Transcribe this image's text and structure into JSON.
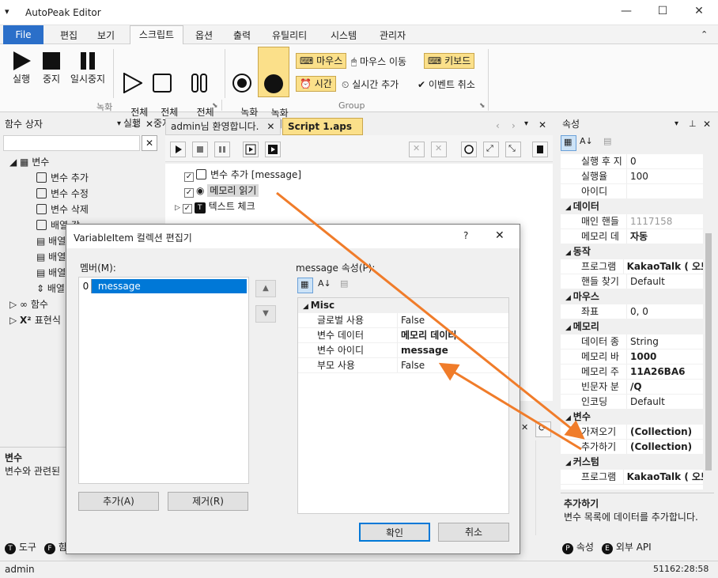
{
  "app": {
    "title": "AutoPeak Editor"
  },
  "menu": {
    "file": "File",
    "items": [
      "편집",
      "보기",
      "스크립트",
      "옵션",
      "출력",
      "유틸리티",
      "시스템",
      "관리자"
    ]
  },
  "ribbon": {
    "record_buttons": [
      "실행",
      "중지",
      "일시중지",
      "전체\n실행",
      "전체\n중지",
      "전체\n일시중지",
      "녹화\n시작",
      "녹화\n중지"
    ],
    "group_record": "녹화",
    "group_group": "Group",
    "chips": {
      "mouse": "마우스",
      "mouse_move": "마우스 이동",
      "keyboard": "키보드",
      "time": "시간",
      "realtime_add": "실시간 추가",
      "event_cancel": "이벤트 취소"
    }
  },
  "left_panel": {
    "title": "함수 상자",
    "tree": [
      "변수",
      "변수 추가",
      "변수 수정",
      "변수 삭제",
      "배열 값",
      "배열",
      "배열",
      "배열",
      "배열",
      "함수",
      "표현식"
    ],
    "desc_title": "변수",
    "desc_text": "변수와 관련된",
    "tabs": [
      "도구",
      "함"
    ]
  },
  "doc_tabs": {
    "tab1": "admin님 환영합니다.",
    "tab2": "Script 1.aps"
  },
  "script": {
    "rows": [
      "변수 추가 [message]",
      "메모리 읽기",
      "텍스트 체크"
    ]
  },
  "right_panel": {
    "title": "속성",
    "rows": [
      {
        "k": "실행 후 지",
        "v": "0",
        "cat": false
      },
      {
        "k": "실행율",
        "v": "100",
        "cat": false
      },
      {
        "k": "아이디",
        "v": "",
        "cat": false
      },
      {
        "k": "데이터",
        "v": "",
        "cat": true
      },
      {
        "k": "매인 핸들",
        "v": "1117158",
        "cat": false,
        "gray": true
      },
      {
        "k": "메모리 데",
        "v": "자동",
        "cat": false,
        "bold": true
      },
      {
        "k": "동작",
        "v": "",
        "cat": true
      },
      {
        "k": "프로그램",
        "v": "KakaoTalk ( 오토",
        "cat": false,
        "bold": true
      },
      {
        "k": "핸들 찾기",
        "v": "Default",
        "cat": false
      },
      {
        "k": "마우스",
        "v": "",
        "cat": true
      },
      {
        "k": "좌표",
        "v": "0, 0",
        "cat": false
      },
      {
        "k": "메모리",
        "v": "",
        "cat": true
      },
      {
        "k": "데이터 종",
        "v": "String",
        "cat": false
      },
      {
        "k": "메모리 바",
        "v": "1000",
        "cat": false,
        "bold": true
      },
      {
        "k": "메모리 주",
        "v": "11A26BA6",
        "cat": false,
        "bold": true
      },
      {
        "k": "빈문자 분",
        "v": "/Q",
        "cat": false,
        "bold": true
      },
      {
        "k": "인코딩",
        "v": "Default",
        "cat": false
      },
      {
        "k": "변수",
        "v": "",
        "cat": true
      },
      {
        "k": "가져오기",
        "v": "(Collection)",
        "cat": false,
        "bold": true
      },
      {
        "k": "추가하기",
        "v": "(Collection)",
        "cat": false,
        "bold": true
      },
      {
        "k": "커스텀",
        "v": "",
        "cat": true
      },
      {
        "k": "프로그램",
        "v": "KakaoTalk ( 오토",
        "cat": false,
        "bold": true
      }
    ],
    "desc_title": "추가하기",
    "desc_text": "변수 목록에 데이터를 추가합니다.",
    "tabs": [
      "속성",
      "외부 API"
    ]
  },
  "dialog": {
    "title": "VariableItem 컬렉션 편집기",
    "help": "?",
    "members_label": "멤버(M):",
    "member_index": "0",
    "member_name": "message",
    "props_label": "message 속성(P):",
    "category": "Misc",
    "props": [
      {
        "k": "글로벌 사용",
        "v": "False",
        "bold": false
      },
      {
        "k": "변수 데이터",
        "v": "메모리 데이터",
        "bold": true
      },
      {
        "k": "변수 아이디",
        "v": "message",
        "bold": true
      },
      {
        "k": "부모 사용",
        "v": "False",
        "bold": false
      }
    ],
    "add_btn": "추가(A)",
    "remove_btn": "제거(R)",
    "ok_btn": "확인",
    "cancel_btn": "취소"
  },
  "status": {
    "user": "admin",
    "time": "51162:28:58"
  },
  "colors": {
    "accent": "#2b6fc9",
    "arrow": "#f07c2a",
    "highlight": "#fbe08a",
    "selection": "#0078d7"
  }
}
